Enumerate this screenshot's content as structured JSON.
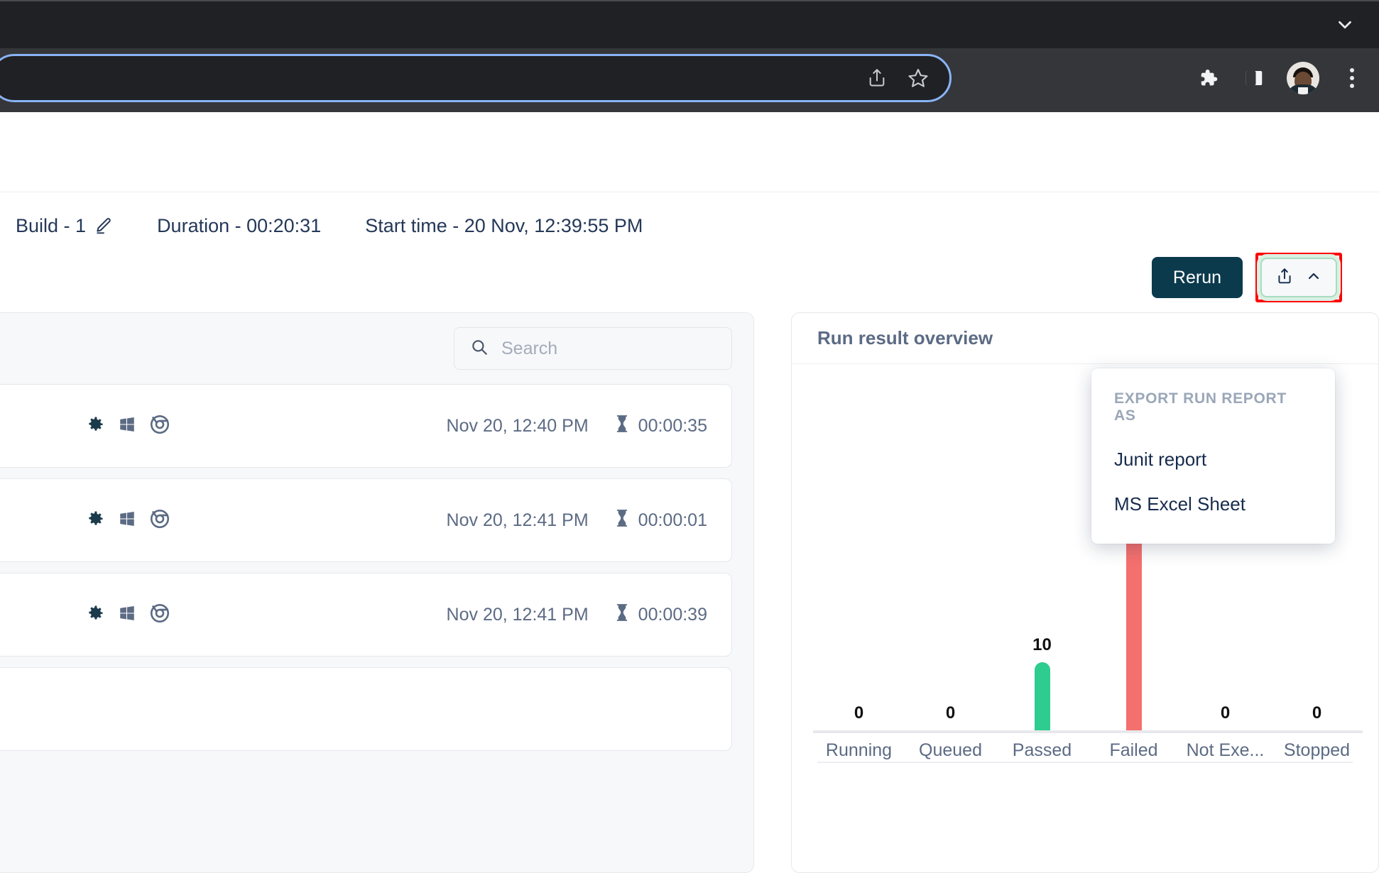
{
  "browser": {
    "tab_chevron_icon": "chevron-down-icon",
    "omnibox": {
      "value": "",
      "share_icon": "share-icon",
      "bookmark_icon": "star-icon"
    },
    "extensions_icon": "puzzle-piece-icon",
    "sidepanel_icon": "side-panel-icon",
    "profile_icon": "avatar",
    "menu_icon": "kebab-menu-icon"
  },
  "header": {
    "build_label": "Build - 1",
    "edit_icon": "pencil-icon",
    "duration_label": "Duration - 00:20:31",
    "start_time_label": "Start time - 20 Nov, 12:39:55 PM"
  },
  "actions": {
    "rerun_label": "Rerun",
    "export_icon": "share-icon",
    "export_chevron_icon": "chevron-up-icon"
  },
  "export_menu": {
    "title": "EXPORT RUN REPORT AS",
    "items": [
      {
        "label": "Junit report"
      },
      {
        "label": "MS Excel Sheet"
      }
    ]
  },
  "left_panel": {
    "search": {
      "placeholder": "Search",
      "value": "",
      "icon": "search-icon"
    },
    "rows": [
      {
        "gear_icon": "gear-icon",
        "os_icon": "windows-icon",
        "browser_icon": "chrome-icon",
        "timestamp": "Nov 20, 12:40 PM",
        "duration_icon": "hourglass-icon",
        "duration": "00:00:35"
      },
      {
        "gear_icon": "gear-icon",
        "os_icon": "windows-icon",
        "browser_icon": "chrome-icon",
        "timestamp": "Nov 20, 12:41 PM",
        "duration_icon": "hourglass-icon",
        "duration": "00:00:01"
      },
      {
        "gear_icon": "gear-icon",
        "os_icon": "windows-icon",
        "browser_icon": "chrome-icon",
        "timestamp": "Nov 20, 12:41 PM",
        "duration_icon": "hourglass-icon",
        "duration": "00:00:39"
      },
      {
        "gear_icon": "gear-icon",
        "os_icon": "windows-icon",
        "browser_icon": "chrome-icon",
        "timestamp": "",
        "duration_icon": "hourglass-icon",
        "duration": ""
      }
    ]
  },
  "chart_card": {
    "title": "Run result overview"
  },
  "chart_data": {
    "type": "bar",
    "title": "Run result overview",
    "xlabel": "",
    "ylabel": "",
    "categories": [
      "Running",
      "Queued",
      "Passed",
      "Failed",
      "Not Exe...",
      "Stopped"
    ],
    "values": [
      0,
      0,
      10,
      38,
      0,
      0
    ],
    "colors": [
      "#3fa66b",
      "#5b7cfa",
      "#2ecc8f",
      "#f4706e",
      "#6a5ae0",
      "#9aa5ad"
    ],
    "labels": [
      "0",
      "0",
      "10",
      "38",
      "0",
      "0"
    ],
    "ylim": [
      0,
      42
    ],
    "grid": false,
    "legend": "none"
  }
}
